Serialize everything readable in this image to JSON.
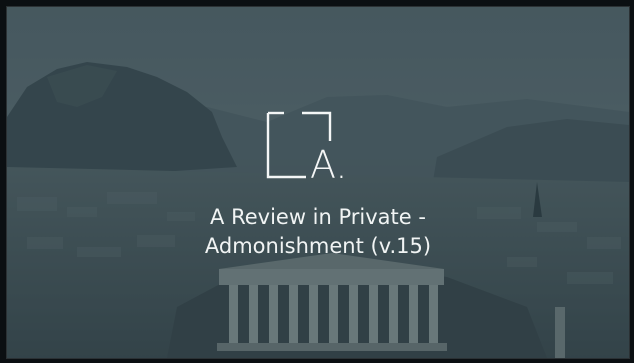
{
  "slide": {
    "background_image": "acropolis-athens-landscape",
    "logo_icon": "a-logo-icon",
    "logo_letter": "A.",
    "title_line1": "A Review in Private -",
    "title_line2": "Admonishment (v.15)"
  },
  "colors": {
    "text": "#f1f4f4",
    "overlay": "#263a42",
    "frame": "#0b0f12"
  }
}
